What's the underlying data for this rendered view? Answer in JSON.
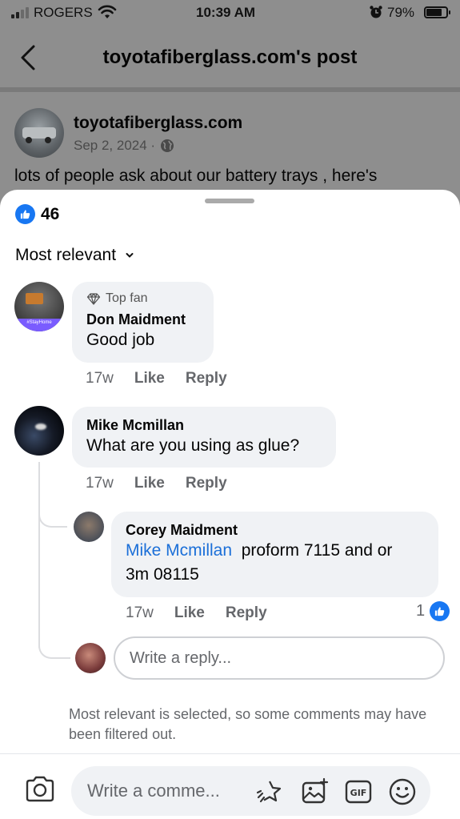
{
  "status_bar": {
    "carrier": "ROGERS",
    "time": "10:39 AM",
    "battery": "79%"
  },
  "header": {
    "title": "toyotafiberglass.com's post"
  },
  "post": {
    "author": "toyotafiberglass.com",
    "date": "Sep 2, 2024 ·",
    "text": "lots of people ask about our battery trays  , here's"
  },
  "comments_sheet": {
    "likes_count": "46",
    "sort_label": "Most relevant",
    "comments": [
      {
        "badge": "Top fan",
        "author": "Don Maidment",
        "text": "Good job",
        "time": "17w",
        "like_label": "Like",
        "reply_label": "Reply"
      },
      {
        "author": "Mike Mcmillan",
        "text": "What are you using as glue?",
        "time": "17w",
        "like_label": "Like",
        "reply_label": "Reply",
        "replies": [
          {
            "author": "Corey Maidment",
            "mention": "Mike Mcmillan",
            "text_line1": "proform 7115 and or",
            "text_line2": "3m 08115",
            "time": "17w",
            "like_label": "Like",
            "reply_label": "Reply",
            "like_count": "1"
          }
        ]
      }
    ],
    "reply_placeholder": "Write a reply...",
    "filter_note": "Most relevant is selected, so some comments may have been filtered out.",
    "comment_placeholder": "Write a comme..."
  },
  "colors": {
    "accent": "#1877f2",
    "bubble": "#f0f2f5",
    "secondary_text": "#65676b"
  }
}
